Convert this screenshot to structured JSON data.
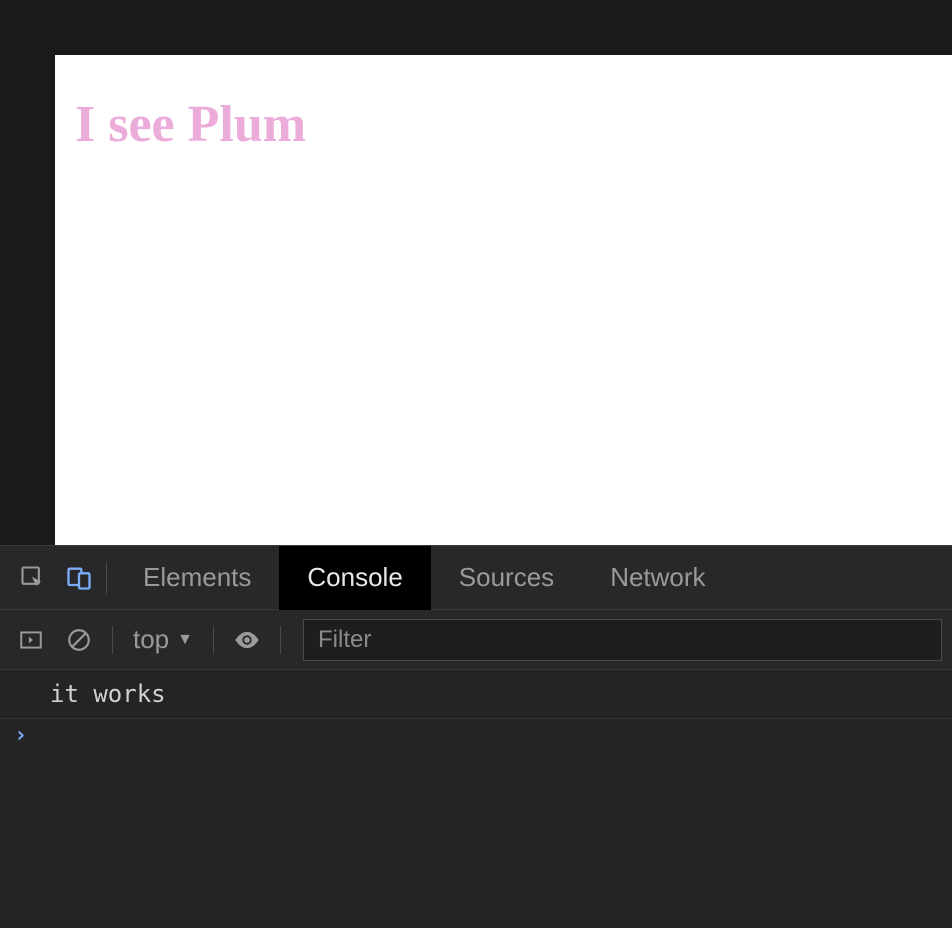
{
  "page": {
    "heading": "I see Plum"
  },
  "devtools": {
    "tabs": {
      "elements": "Elements",
      "console": "Console",
      "sources": "Sources",
      "network": "Network"
    },
    "toolbar": {
      "context": "top",
      "filter_placeholder": "Filter"
    },
    "console": {
      "messages": [
        "it works"
      ],
      "prompt": "›"
    }
  }
}
